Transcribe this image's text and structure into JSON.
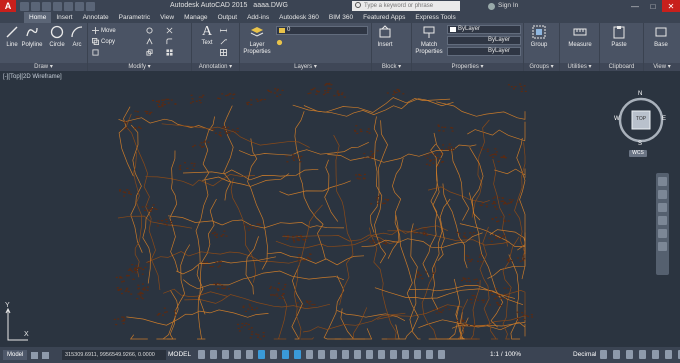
{
  "window": {
    "title": "Autodesk AutoCAD 2015",
    "file": "aaaa.DWG",
    "search_placeholder": "Type a keyword or phrase",
    "sign_in": "Sign In"
  },
  "tabs": [
    "Home",
    "Insert",
    "Annotate",
    "Parametric",
    "View",
    "Manage",
    "Output",
    "Add-ins",
    "Autodesk 360",
    "BIM 360",
    "Featured Apps",
    "Express Tools"
  ],
  "ribbon": {
    "draw": {
      "label": "Draw",
      "tools": [
        "Line",
        "Polyline",
        "Circle",
        "Arc"
      ]
    },
    "modify": {
      "label": "Modify",
      "tools": [
        "Move",
        "Copy"
      ]
    },
    "annotation": {
      "label": "Annotation",
      "tools": [
        "Text"
      ]
    },
    "layers": {
      "label": "Layers",
      "tool": "Layer Properties",
      "current_layer": "0"
    },
    "block": {
      "label": "Block",
      "tool": "Insert"
    },
    "properties": {
      "label": "Properties",
      "tool": "Match Properties",
      "color": "ByLayer",
      "linetype": "ByLayer",
      "lineweight": "ByLayer"
    },
    "groups": {
      "label": "Groups",
      "tool": "Group"
    },
    "utilities": {
      "label": "Utilities",
      "tool": "Measure"
    },
    "clipboard": {
      "label": "Clipboard",
      "tool": "Paste"
    },
    "view": {
      "label": "View",
      "tool": "Base"
    }
  },
  "viewport_label": "[-][Top][2D Wireframe]",
  "viewcube": {
    "top": "TOP",
    "n": "N",
    "s": "S",
    "e": "E",
    "w": "W",
    "wcs": "WCS"
  },
  "statusbar": {
    "model_tab": "Model",
    "coordinates": "315309.6911, 9956549.9266, 0.0000",
    "mode": "MODEL",
    "scale": "1:1 / 100%",
    "units": "Decimal"
  },
  "colors": {
    "contour": "#c87a2a",
    "contour_dark": "#8a4a18",
    "background": "#2b3440",
    "ribbon": "#4a5364"
  }
}
